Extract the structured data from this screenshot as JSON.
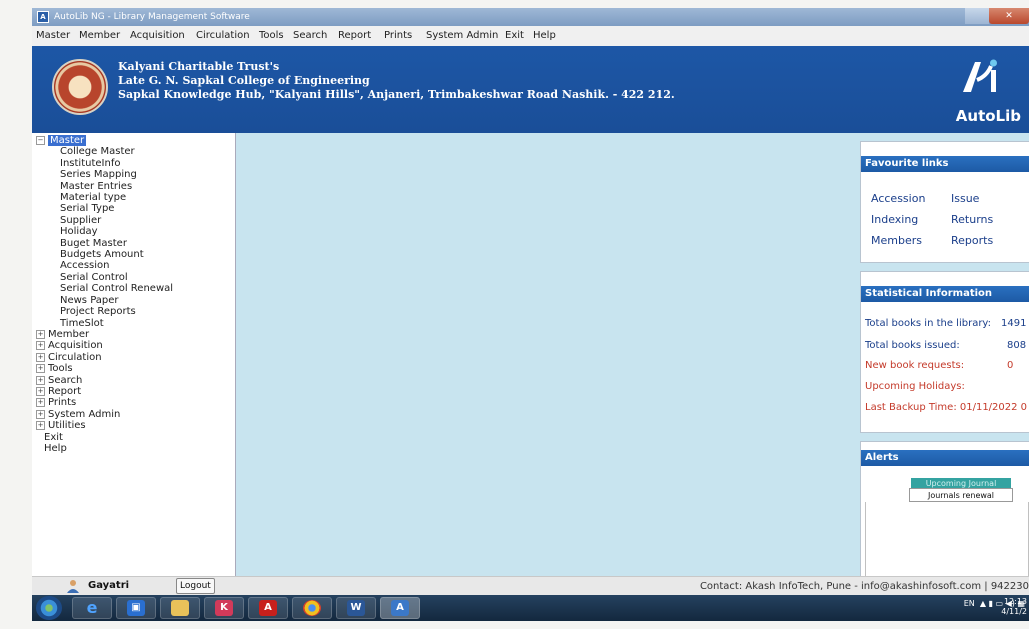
{
  "window": {
    "title": "AutoLib NG - Library Management Software"
  },
  "menu": [
    "Master",
    "Member",
    "Acquisition",
    "Circulation",
    "Tools",
    "Search",
    "Report",
    "Prints",
    "System Admin",
    "Exit",
    "Help"
  ],
  "banner": {
    "line1": "Kalyani Charitable Trust's",
    "line2": "Late G. N. Sapkal College of Engineering",
    "line3": "Sapkal Knowledge Hub, \"Kalyani Hills\", Anjaneri, Trimbakeshwar Road Nashik. - 422 212.",
    "brand": "AutoLib"
  },
  "tree": {
    "root": "Master",
    "children": [
      "College Master",
      "InstituteInfo",
      "Series Mapping",
      "Master Entries",
      "Material type",
      "Serial Type",
      "Supplier",
      "Holiday",
      "Buget Master",
      "Budgets Amount",
      "Accession",
      "Serial Control",
      "Serial Control Renewal",
      "News Paper",
      "Project Reports",
      "TimeSlot"
    ],
    "collapsed": [
      "Member",
      "Acquisition",
      "Circulation",
      "Tools",
      "Search",
      "Report",
      "Prints",
      "System Admin",
      "Utilities"
    ],
    "plain": [
      "Exit",
      "Help"
    ]
  },
  "favourites": {
    "title": "Favourite links",
    "links": [
      "Accession",
      "Issue",
      "Indexing",
      "Returns",
      "Members",
      "Reports"
    ]
  },
  "stats": {
    "title": "Statistical Information",
    "total_books_label": "Total books in the library:",
    "total_books_value": "1491",
    "issued_label": "Total books issued:",
    "issued_value": "808",
    "requests_label": "New book requests:",
    "requests_value": "0",
    "holidays_label": "Upcoming Holidays:",
    "backup": "Last Backup Time: 01/11/2022 0"
  },
  "alerts": {
    "title": "Alerts",
    "tab_upcoming": "Upcoming Journal",
    "tab_renewal": "Journals renewal"
  },
  "statusbar": {
    "user": "Gayatri",
    "logout": "Logout",
    "contact": "Contact: Akash InfoTech, Pune - info@akashinfosoft.com | 942230"
  },
  "taskbar": {
    "lang": "EN",
    "time": "12:13",
    "date": "4/11/2"
  }
}
